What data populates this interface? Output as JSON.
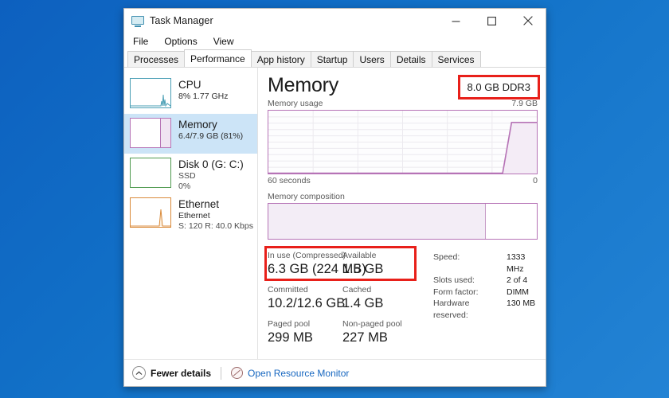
{
  "window": {
    "title": "Task Manager",
    "app_icon": "task-manager-icon",
    "minimize": "minimize-icon",
    "maximize": "maximize-icon",
    "close": "close-icon"
  },
  "menubar": {
    "items": [
      {
        "label": "File"
      },
      {
        "label": "Options"
      },
      {
        "label": "View"
      }
    ]
  },
  "tabs": [
    {
      "label": "Processes",
      "selected": false
    },
    {
      "label": "Performance",
      "selected": true
    },
    {
      "label": "App history",
      "selected": false
    },
    {
      "label": "Startup",
      "selected": false
    },
    {
      "label": "Users",
      "selected": false
    },
    {
      "label": "Details",
      "selected": false
    },
    {
      "label": "Services",
      "selected": false
    }
  ],
  "sidebar": {
    "items": [
      {
        "title": "CPU",
        "sub1": "8%  1.77 GHz",
        "sub2": "",
        "color": "#4a9fb5",
        "selected": false
      },
      {
        "title": "Memory",
        "sub1": "6.4/7.9 GB (81%)",
        "sub2": "",
        "color": "#b673b6",
        "selected": true
      },
      {
        "title": "Disk 0 (G: C:)",
        "sub1": "SSD",
        "sub2": "0%",
        "color": "#4f9a4f",
        "selected": false
      },
      {
        "title": "Ethernet",
        "sub1": "Ethernet",
        "sub2": "S: 120 R: 40.0 Kbps",
        "color": "#d98a3a",
        "selected": false
      }
    ]
  },
  "main": {
    "heading": "Memory",
    "ram_badge": "8.0 GB DDR3",
    "usage_graph_label": "Memory usage",
    "usage_graph_max": "7.9 GB",
    "axis_left": "60 seconds",
    "axis_right": "0",
    "composition_label": "Memory composition",
    "stats": [
      [
        {
          "key": "In use (Compressed)",
          "value": "6.3 GB (224 MB)"
        },
        {
          "key": "Available",
          "value": "1.5 GB"
        }
      ],
      [
        {
          "key": "Committed",
          "value": "10.2/12.6 GB"
        },
        {
          "key": "Cached",
          "value": "1.4 GB"
        }
      ],
      [
        {
          "key": "Paged pool",
          "value": "299 MB"
        },
        {
          "key": "Non-paged pool",
          "value": "227 MB"
        }
      ]
    ],
    "details": [
      {
        "key": "Speed:",
        "value": "1333 MHz"
      },
      {
        "key": "Slots used:",
        "value": "2 of 4"
      },
      {
        "key": "Form factor:",
        "value": "DIMM"
      },
      {
        "key": "Hardware reserved:",
        "value": "130 MB"
      }
    ]
  },
  "footer": {
    "fewer_details": "Fewer details",
    "resource_monitor": "Open Resource Monitor"
  },
  "chart_data": {
    "type": "area",
    "title": "Memory usage",
    "xlabel": "60 seconds",
    "ylabel": "",
    "ylim": [
      0,
      7.9
    ],
    "y_max_label": "7.9 GB",
    "x_left_label": "60 seconds",
    "x_right_label": "0",
    "grid": true,
    "grid_columns": 6,
    "grid_rows": 10,
    "line_color": "#b673b6",
    "fill_color": "#f4ecf6",
    "series": [
      {
        "name": "Memory usage",
        "x": [
          0,
          54,
          58,
          60
        ],
        "values": [
          0.0,
          0.0,
          6.4,
          6.4
        ]
      }
    ]
  },
  "composition_data": {
    "type": "bar",
    "title": "Memory composition",
    "segments": [
      {
        "name": "In use",
        "fraction": 0.81,
        "color": "#f3edf6"
      },
      {
        "name": "Available",
        "fraction": 0.19,
        "color": "#ffffff"
      }
    ]
  },
  "colors": {
    "accent_blue": "#1767c0",
    "highlight_red": "#e8201a",
    "memory_purple": "#b673b6",
    "selection_blue": "#cce4f7",
    "desktop_gradient_from": "#0d60bf",
    "desktop_gradient_to": "#2383d4"
  }
}
